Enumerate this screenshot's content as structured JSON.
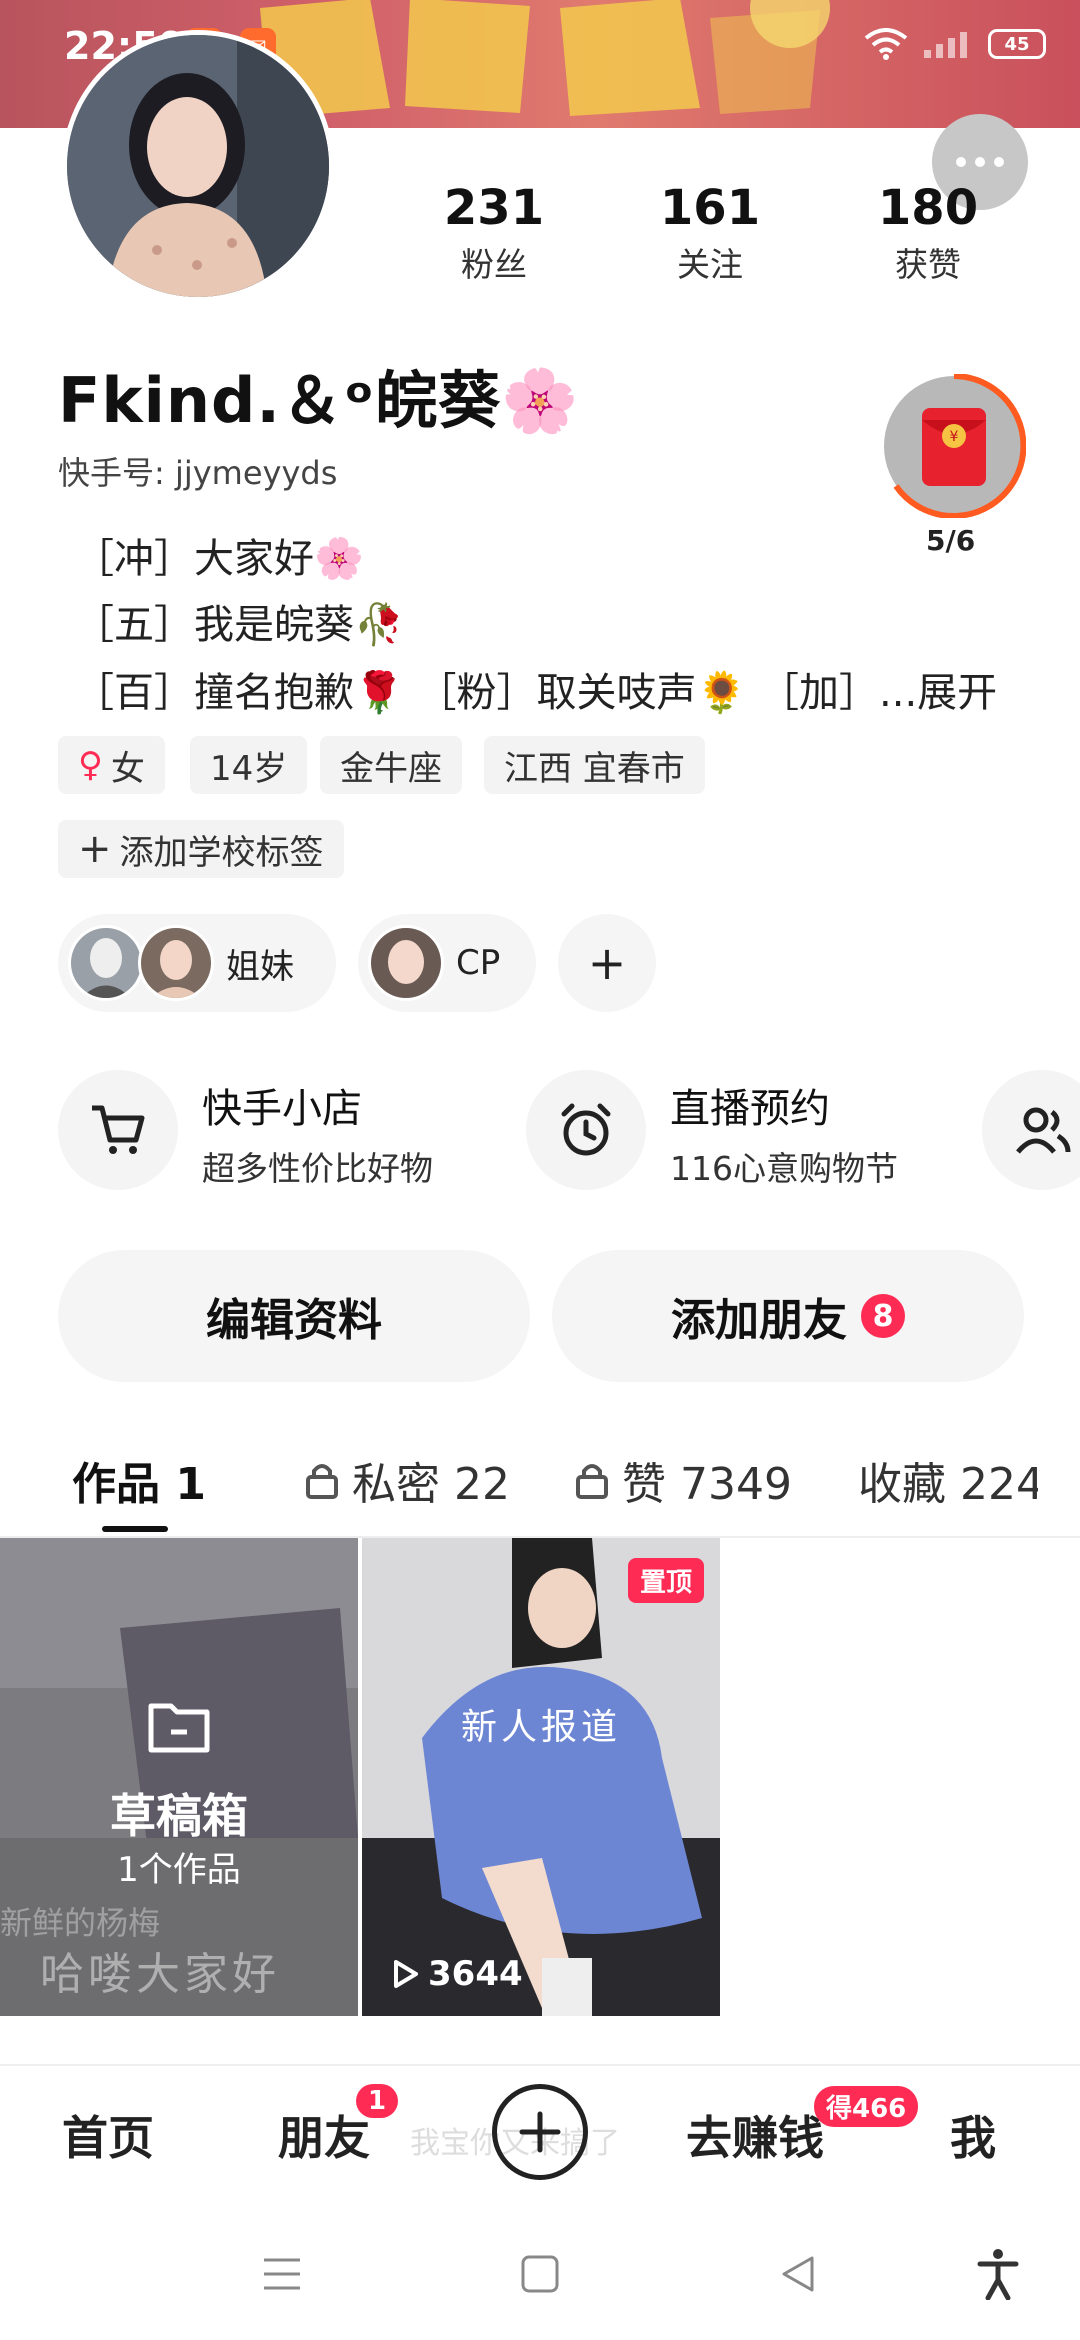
{
  "status_bar": {
    "time": "22:59",
    "battery": "45"
  },
  "profile": {
    "stats": [
      {
        "value": "231",
        "label": "粉丝"
      },
      {
        "value": "161",
        "label": "关注"
      },
      {
        "value": "180",
        "label": "获赞"
      }
    ],
    "name": "Fkind.＆ᵒ皖葵🌸",
    "kuaishou_id": "快手号: jjymeyyds",
    "redpacket_progress": "5/6",
    "bio": [
      "［冲］大家好🌸",
      "［五］我是皖葵🥀",
      "［百］撞名抱歉🌹 ［粉］取关吱声🌻 ［加］...展开"
    ],
    "tags": [
      "女",
      "14岁",
      "金牛座",
      "江西 宜春市"
    ],
    "add_school": "添加学校标签",
    "relations": [
      {
        "label": "姐妹"
      },
      {
        "label": "CP"
      }
    ]
  },
  "services": [
    {
      "title": "快手小店",
      "subtitle": "超多性价比好物"
    },
    {
      "title": "直播预约",
      "subtitle": "116心意购物节"
    }
  ],
  "actions": {
    "edit": "编辑资料",
    "add_friend": "添加朋友",
    "add_friend_badge": "8"
  },
  "tabs": [
    {
      "label": "作品 1"
    },
    {
      "label": "私密 22"
    },
    {
      "label": "赞 7349"
    },
    {
      "label": "收藏 224"
    }
  ],
  "grid": {
    "draft": {
      "title": "草稿箱",
      "count": "1个作品",
      "overlay_text": "哈喽大家好",
      "overlay_text2": "新鲜的杨梅"
    },
    "video": {
      "pin": "置顶",
      "caption": "新人报道",
      "plays": "3644"
    }
  },
  "bottom_nav": {
    "home": "首页",
    "friends": "朋友",
    "friends_badge": "1",
    "earn": "去赚钱",
    "earn_badge": "得466",
    "me": "我",
    "ghost_text": "我宝你又来搞了"
  },
  "colors": {
    "accent": "#fe2c55",
    "banner": "#d0606a"
  }
}
